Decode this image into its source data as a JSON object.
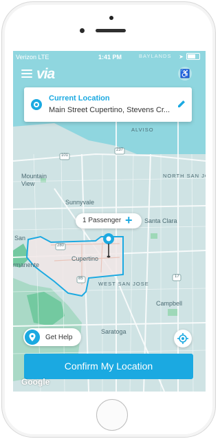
{
  "status_bar": {
    "carrier": "Verizon LTE",
    "time": "1:41 PM",
    "location_label": "BAYLANDS"
  },
  "header": {
    "brand": "via",
    "menu_icon": "menu-icon",
    "accessibility_icon": "wheelchair-icon"
  },
  "location_card": {
    "title": "Current Location",
    "address": "Main Street Cupertino, Stevens Cr...",
    "edit_icon": "pencil-icon"
  },
  "passenger": {
    "label": "1 Passenger",
    "add_symbol": "+"
  },
  "map_labels": {
    "alviso": "ALVISO",
    "mountain_view": "Mountain\nView",
    "north_san_jose": "NORTH SAN JO",
    "sunnyvale": "Sunnyvale",
    "santa_clara": "Santa Clara",
    "cupertino": "Cupertino",
    "west_san_jose": "WEST SAN JOSE",
    "campbell": "Campbell",
    "saratoga": "Saratoga",
    "san": "San",
    "rmanente": "rmanente",
    "road_237": "237",
    "road_101": "101",
    "road_280": "280",
    "road_85": "85",
    "road_17": "17"
  },
  "help_button": {
    "label": "Get Help"
  },
  "confirm_button": {
    "label": "Confirm My Location"
  },
  "google_logo": "Google",
  "colors": {
    "accent": "#1ba9e1",
    "water": "#8fd6df",
    "zone_outline": "#1ba9e1"
  }
}
